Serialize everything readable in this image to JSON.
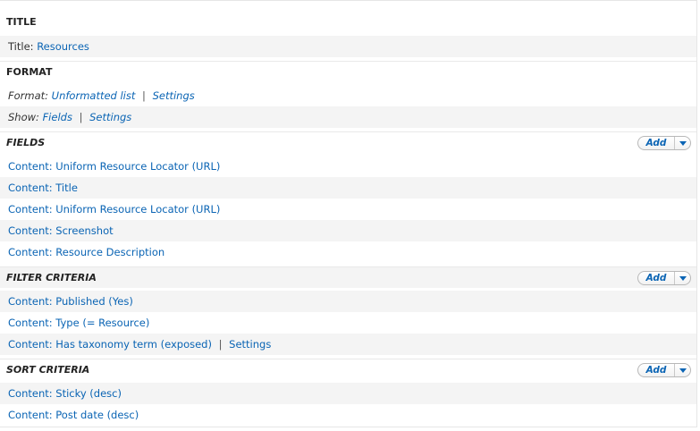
{
  "title_section": {
    "heading": "TITLE",
    "title_label": "Title:",
    "title_value": "Resources"
  },
  "format_section": {
    "heading": "FORMAT",
    "format_label": "Format:",
    "format_value": "Unformatted list",
    "format_settings": "Settings",
    "show_label": "Show:",
    "show_value": "Fields",
    "show_settings": "Settings",
    "separator": "|"
  },
  "fields_section": {
    "heading": "FIELDS",
    "add_label": "Add",
    "items": [
      "Content: Uniform Resource Locator (URL)",
      "Content: Title",
      "Content: Uniform Resource Locator (URL)",
      "Content: Screenshot",
      "Content: Resource Description"
    ]
  },
  "filter_section": {
    "heading": "FILTER CRITERIA",
    "add_label": "Add",
    "items": [
      "Content: Published (Yes)",
      "Content: Type (= Resource)",
      "Content: Has taxonomy term (exposed)"
    ],
    "item3_settings": "Settings",
    "separator": "|"
  },
  "sort_section": {
    "heading": "SORT CRITERIA",
    "add_label": "Add",
    "items": [
      "Content: Sticky (desc)",
      "Content: Post date (desc)"
    ]
  },
  "colors": {
    "link": "#0a64b4",
    "row_alt": "#f4f4f4"
  },
  "icons": {
    "add_dropdown": "chevron-down-icon"
  }
}
